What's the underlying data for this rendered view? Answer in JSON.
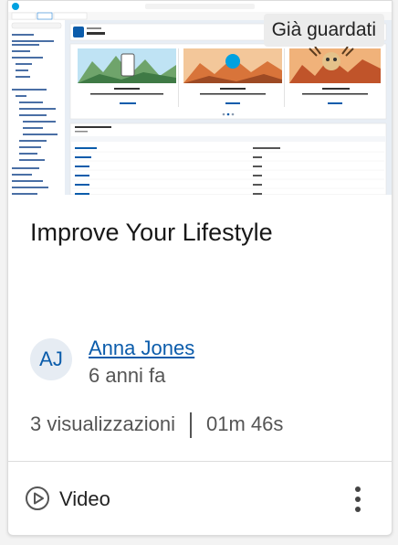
{
  "thumbnail": {
    "alt_icon": "salesforce-setup-screenshot",
    "badge": "Già guardati",
    "app_title": "Home",
    "panels": [
      {
        "title": "Mobile Publisher",
        "button": "Learn More"
      },
      {
        "title": "Go Mobile",
        "button": "Get Started"
      },
      {
        "title": "Free AppExchange",
        "button": "Get Started"
      }
    ],
    "recent_title": "Most Recently Used"
  },
  "card": {
    "title": "Improve Your Lifestyle",
    "author_initials": "AJ",
    "author_name": "Anna Jones",
    "posted": "6 anni fa",
    "views": "3 visualizzazioni",
    "duration": "01m 46s",
    "type_label": "Video",
    "type_icon": "play-circle-icon",
    "menu_icon": "more-vertical-icon"
  },
  "colors": {
    "accent": "#0b5cab",
    "salesforce_blue": "#00a1e0"
  }
}
